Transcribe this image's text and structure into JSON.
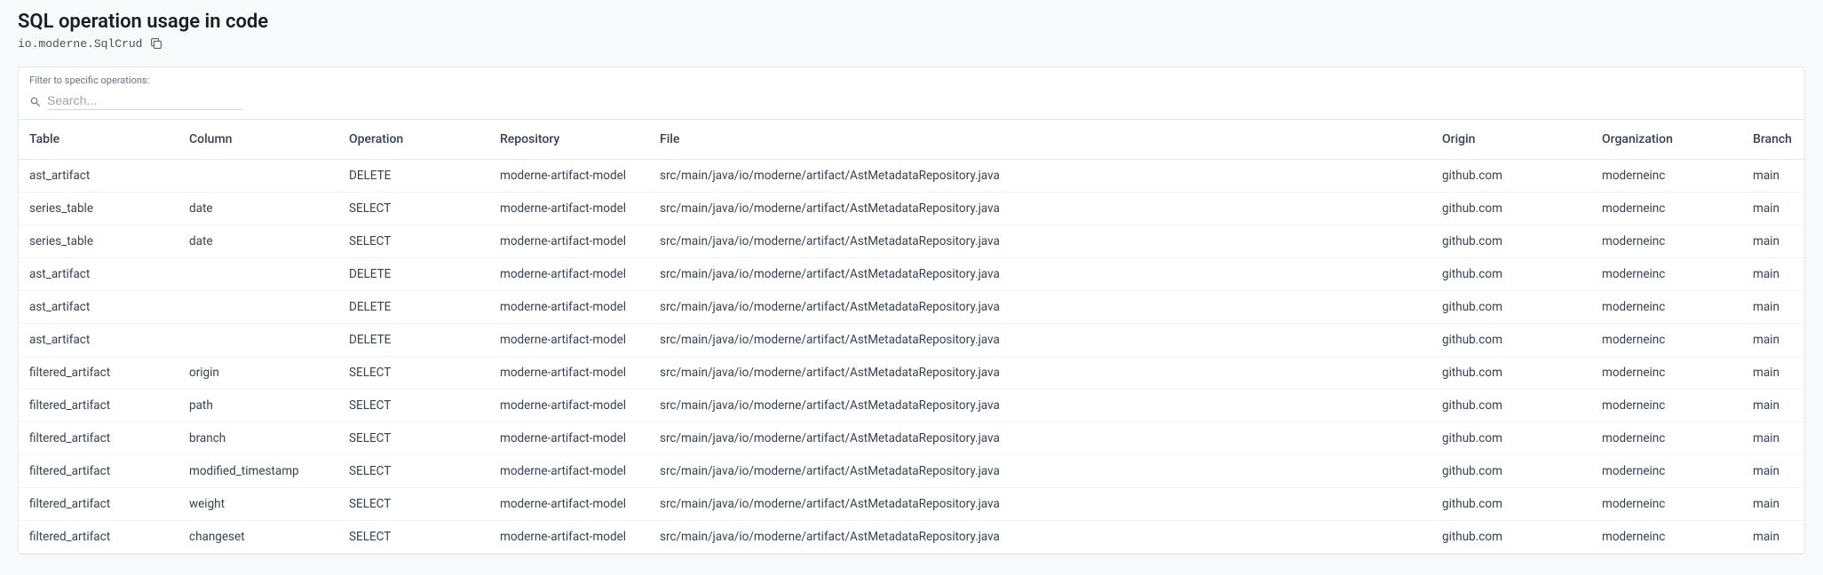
{
  "header": {
    "title": "SQL operation usage in code",
    "subtitle_code": "io.moderne.SqlCrud"
  },
  "filter": {
    "label": "Filter to specific operations:",
    "search_placeholder": "Search..."
  },
  "table": {
    "columns": {
      "table": "Table",
      "column": "Column",
      "operation": "Operation",
      "repository": "Repository",
      "file": "File",
      "origin": "Origin",
      "organization": "Organization",
      "branch": "Branch"
    },
    "rows": [
      {
        "table": "ast_artifact",
        "column": "",
        "operation": "DELETE",
        "repository": "moderne-artifact-model",
        "file": "src/main/java/io/moderne/artifact/AstMetadataRepository.java",
        "origin": "github.com",
        "organization": "moderneinc",
        "branch": "main"
      },
      {
        "table": "series_table",
        "column": "date",
        "operation": "SELECT",
        "repository": "moderne-artifact-model",
        "file": "src/main/java/io/moderne/artifact/AstMetadataRepository.java",
        "origin": "github.com",
        "organization": "moderneinc",
        "branch": "main"
      },
      {
        "table": "series_table",
        "column": "date",
        "operation": "SELECT",
        "repository": "moderne-artifact-model",
        "file": "src/main/java/io/moderne/artifact/AstMetadataRepository.java",
        "origin": "github.com",
        "organization": "moderneinc",
        "branch": "main"
      },
      {
        "table": "ast_artifact",
        "column": "",
        "operation": "DELETE",
        "repository": "moderne-artifact-model",
        "file": "src/main/java/io/moderne/artifact/AstMetadataRepository.java",
        "origin": "github.com",
        "organization": "moderneinc",
        "branch": "main"
      },
      {
        "table": "ast_artifact",
        "column": "",
        "operation": "DELETE",
        "repository": "moderne-artifact-model",
        "file": "src/main/java/io/moderne/artifact/AstMetadataRepository.java",
        "origin": "github.com",
        "organization": "moderneinc",
        "branch": "main"
      },
      {
        "table": "ast_artifact",
        "column": "",
        "operation": "DELETE",
        "repository": "moderne-artifact-model",
        "file": "src/main/java/io/moderne/artifact/AstMetadataRepository.java",
        "origin": "github.com",
        "organization": "moderneinc",
        "branch": "main"
      },
      {
        "table": "filtered_artifact",
        "column": "origin",
        "operation": "SELECT",
        "repository": "moderne-artifact-model",
        "file": "src/main/java/io/moderne/artifact/AstMetadataRepository.java",
        "origin": "github.com",
        "organization": "moderneinc",
        "branch": "main"
      },
      {
        "table": "filtered_artifact",
        "column": "path",
        "operation": "SELECT",
        "repository": "moderne-artifact-model",
        "file": "src/main/java/io/moderne/artifact/AstMetadataRepository.java",
        "origin": "github.com",
        "organization": "moderneinc",
        "branch": "main"
      },
      {
        "table": "filtered_artifact",
        "column": "branch",
        "operation": "SELECT",
        "repository": "moderne-artifact-model",
        "file": "src/main/java/io/moderne/artifact/AstMetadataRepository.java",
        "origin": "github.com",
        "organization": "moderneinc",
        "branch": "main"
      },
      {
        "table": "filtered_artifact",
        "column": "modified_timestamp",
        "operation": "SELECT",
        "repository": "moderne-artifact-model",
        "file": "src/main/java/io/moderne/artifact/AstMetadataRepository.java",
        "origin": "github.com",
        "organization": "moderneinc",
        "branch": "main"
      },
      {
        "table": "filtered_artifact",
        "column": "weight",
        "operation": "SELECT",
        "repository": "moderne-artifact-model",
        "file": "src/main/java/io/moderne/artifact/AstMetadataRepository.java",
        "origin": "github.com",
        "organization": "moderneinc",
        "branch": "main"
      },
      {
        "table": "filtered_artifact",
        "column": "changeset",
        "operation": "SELECT",
        "repository": "moderne-artifact-model",
        "file": "src/main/java/io/moderne/artifact/AstMetadataRepository.java",
        "origin": "github.com",
        "organization": "moderneinc",
        "branch": "main"
      }
    ]
  }
}
